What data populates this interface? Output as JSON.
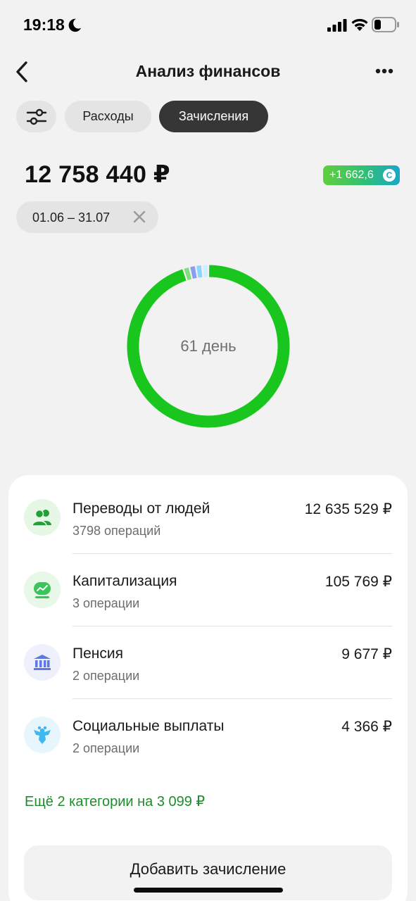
{
  "status_bar": {
    "time": "19:18"
  },
  "header": {
    "title": "Анализ финансов"
  },
  "tabs": [
    {
      "label": "Расходы",
      "active": false
    },
    {
      "label": "Зачисления",
      "active": true
    }
  ],
  "summary": {
    "total": "12 758 440 ₽",
    "bonus": "+1 662,6",
    "bonus_icon": "sber-spasibo-icon"
  },
  "date_filter": {
    "range": "01.06 – 31.07"
  },
  "donut": {
    "center_label": "61 день",
    "segments": [
      {
        "value": 12635529,
        "color": "#19c61e"
      },
      {
        "value": 105769,
        "color": "#7ee07c"
      },
      {
        "value": 9677,
        "color": "#8c9cf0"
      },
      {
        "value": 4366,
        "color": "#8ad6ff"
      },
      {
        "value": 3099,
        "color": "#d2eefc"
      }
    ]
  },
  "categories": [
    {
      "name": "Переводы от людей",
      "count": "3798 операций",
      "amount": "12 635 529 ₽",
      "icon": "people-icon",
      "icon_bg": "#e6f7e6",
      "icon_color": "#21a038"
    },
    {
      "name": "Капитализация",
      "count": "3 операции",
      "amount": "105 769 ₽",
      "icon": "growth-chart-icon",
      "icon_bg": "#e8f8e8",
      "icon_color": "#3ac45a"
    },
    {
      "name": "Пенсия",
      "count": "2 операции",
      "amount": "9 677 ₽",
      "icon": "bank-building-icon",
      "icon_bg": "#eef0fb",
      "icon_color": "#5b79e8"
    },
    {
      "name": "Социальные выплаты",
      "count": "2 операции",
      "amount": "4 366 ₽",
      "icon": "eagle-emblem-icon",
      "icon_bg": "#e7f6fd",
      "icon_color": "#3fb8ee"
    }
  ],
  "more_categories": "Ещё 2 категории на 3 099 ₽",
  "add_button": "Добавить зачисление"
}
